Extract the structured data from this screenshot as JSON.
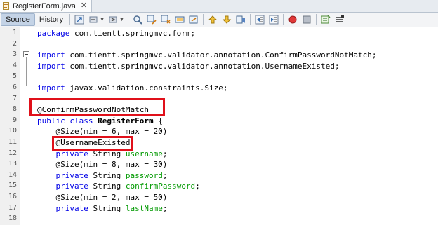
{
  "tab": {
    "title": "RegisterForm.java",
    "close": "✕"
  },
  "toolbar": {
    "source_label": "Source",
    "history_label": "History"
  },
  "editor": {
    "line_numbers": [
      "1",
      "2",
      "3",
      "4",
      "5",
      "6",
      "7",
      "8",
      "9",
      "10",
      "11",
      "12",
      "13",
      "14",
      "15",
      "16",
      "17",
      "18"
    ],
    "lines": [
      [
        {
          "t": "package",
          "c": "kw"
        },
        {
          "t": " com.tientt.springmvc.form;",
          "c": ""
        }
      ],
      [],
      [
        {
          "t": "import",
          "c": "kw"
        },
        {
          "t": " com.tientt.springmvc.validator.annotation.ConfirmPasswordNotMatch;",
          "c": ""
        }
      ],
      [
        {
          "t": "import",
          "c": "kw"
        },
        {
          "t": " com.tientt.springmvc.validator.annotation.UsernameExisted;",
          "c": ""
        }
      ],
      [],
      [
        {
          "t": "import",
          "c": "kw"
        },
        {
          "t": " javax.validation.constraints.Size;",
          "c": ""
        }
      ],
      [],
      [
        {
          "t": "@ConfirmPasswordNotMatch",
          "c": "an"
        }
      ],
      [
        {
          "t": "public",
          "c": "kw"
        },
        {
          "t": " ",
          "c": ""
        },
        {
          "t": "class",
          "c": "kw"
        },
        {
          "t": " ",
          "c": ""
        },
        {
          "t": "RegisterForm",
          "c": "fn"
        },
        {
          "t": " {",
          "c": ""
        }
      ],
      [
        {
          "t": "    @Size(min = 6, max = 20)",
          "c": ""
        }
      ],
      [
        {
          "t": "    @UsernameExisted",
          "c": ""
        }
      ],
      [
        {
          "t": "    ",
          "c": ""
        },
        {
          "t": "private",
          "c": "kw"
        },
        {
          "t": " String ",
          "c": ""
        },
        {
          "t": "username",
          "c": "fld"
        },
        {
          "t": ";",
          "c": ""
        }
      ],
      [
        {
          "t": "    @Size(min = 8, max = 30)",
          "c": ""
        }
      ],
      [
        {
          "t": "    ",
          "c": ""
        },
        {
          "t": "private",
          "c": "kw"
        },
        {
          "t": " String ",
          "c": ""
        },
        {
          "t": "password",
          "c": "fld"
        },
        {
          "t": ";",
          "c": ""
        }
      ],
      [
        {
          "t": "    ",
          "c": ""
        },
        {
          "t": "private",
          "c": "kw"
        },
        {
          "t": " String ",
          "c": ""
        },
        {
          "t": "confirmPassword",
          "c": "fld"
        },
        {
          "t": ";",
          "c": ""
        }
      ],
      [
        {
          "t": "    @Size(min = 2, max = 50)",
          "c": ""
        }
      ],
      [
        {
          "t": "    ",
          "c": ""
        },
        {
          "t": "private",
          "c": "kw"
        },
        {
          "t": " String ",
          "c": ""
        },
        {
          "t": "lastName",
          "c": "fld"
        },
        {
          "t": ";",
          "c": ""
        }
      ],
      []
    ]
  },
  "colors": {
    "keyword": "#0000e6",
    "field": "#009900",
    "highlight": "#e0101a",
    "active_mode": "#c4d3e6"
  }
}
